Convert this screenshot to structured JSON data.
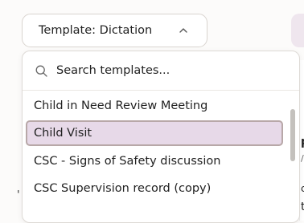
{
  "template_button": {
    "label": "Template: Dictation"
  },
  "search": {
    "placeholder": "Search templates..."
  },
  "items": [
    {
      "label": "Child in Need Review Meeting",
      "selected": false
    },
    {
      "label": "Child Visit",
      "selected": true
    },
    {
      "label": "CSC - Signs of Safety discussion",
      "selected": false
    },
    {
      "label": "CSC Supervision record (copy)",
      "selected": false
    }
  ],
  "background_text": {
    "t1": "p",
    "t2": "/",
    "t3": "c",
    "t4": "t",
    "tick": "'"
  },
  "colors": {
    "selected_bg": "#e7d9e8",
    "selected_border": "#b8a8a8",
    "accent_pill": "#efe6ee"
  },
  "icons": {
    "search": "search-icon",
    "chevron": "chevron-up-icon"
  }
}
